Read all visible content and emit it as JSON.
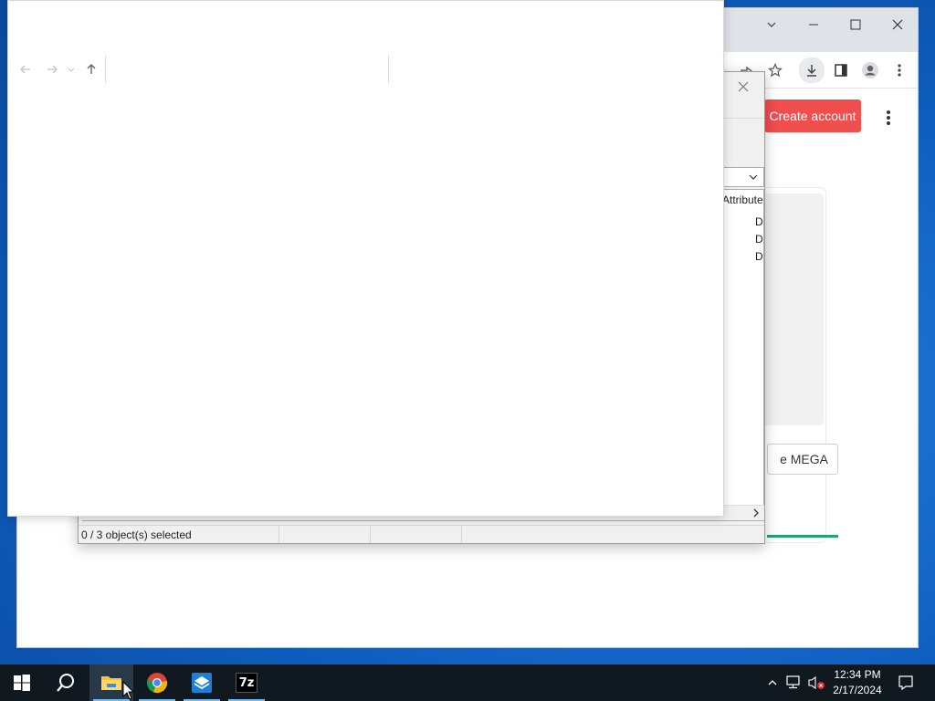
{
  "chrome": {
    "create_account_label": "Create account",
    "mega_button_label": "e MEGA",
    "accent_color": "#f14e4e",
    "progress_color": "#24a46d"
  },
  "sevenzip": {
    "column_attributes": "Attribute",
    "rows": [
      {
        "attr": "D"
      },
      {
        "attr": "D"
      },
      {
        "attr": "D"
      }
    ],
    "status_selected": "0 / 3 object(s) selected"
  },
  "taskbar": {
    "time": "12:34 PM",
    "date": "2/17/2024",
    "apps": [
      "start-icon",
      "search-icon",
      "file-explorer-icon",
      "chrome-icon",
      "sandbox-icon",
      "7zip-icon"
    ],
    "seven_zip_label": "7z"
  }
}
